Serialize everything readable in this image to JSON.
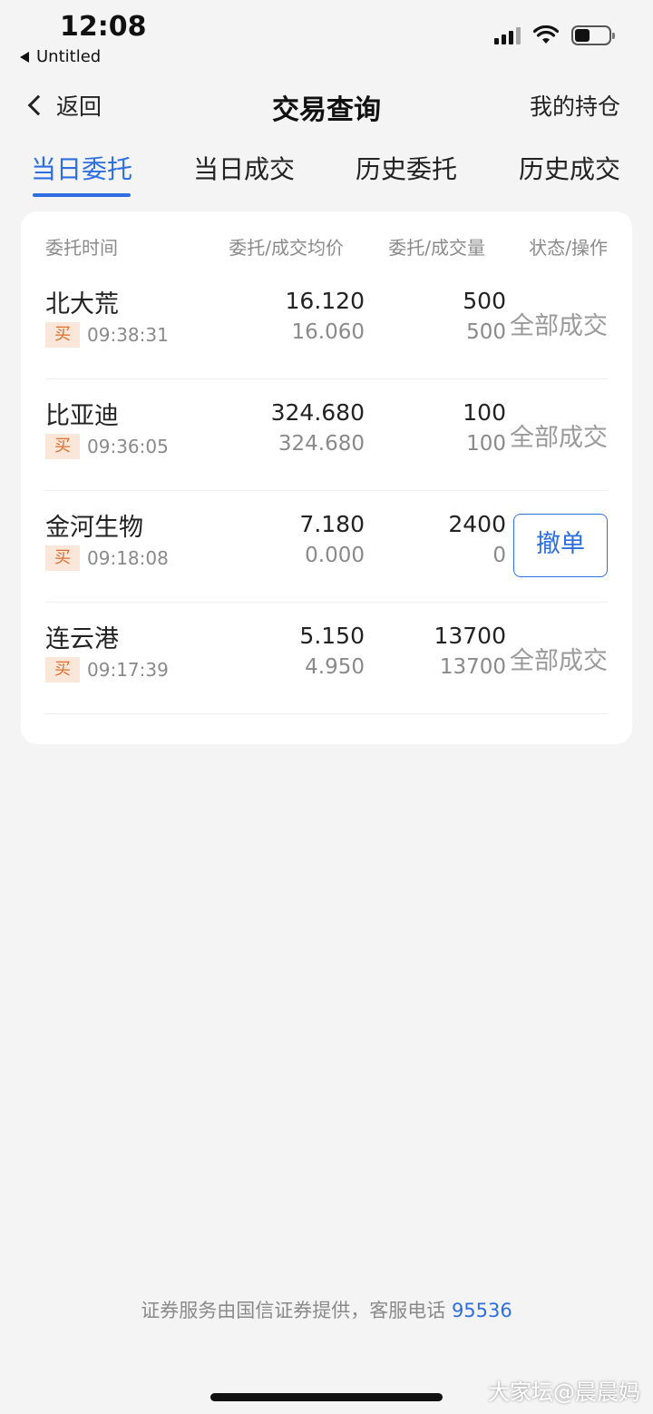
{
  "status_bar": {
    "time": "12:08",
    "back_app": "Untitled"
  },
  "nav": {
    "back_label": "返回",
    "title": "交易查询",
    "right_label": "我的持仓"
  },
  "tabs": [
    {
      "label": "当日委托",
      "active": true
    },
    {
      "label": "当日成交",
      "active": false
    },
    {
      "label": "历史委托",
      "active": false
    },
    {
      "label": "历史成交",
      "active": false
    }
  ],
  "table": {
    "headers": [
      "委托时间",
      "委托/成交均价",
      "委托/成交量",
      "状态/操作"
    ],
    "rows": [
      {
        "name": "北大荒",
        "side": "买",
        "time": "09:38:31",
        "price": "16.120",
        "avg_price": "16.060",
        "qty": "500",
        "filled_qty": "500",
        "status": "全部成交"
      },
      {
        "name": "比亚迪",
        "side": "买",
        "time": "09:36:05",
        "price": "324.680",
        "avg_price": "324.680",
        "qty": "100",
        "filled_qty": "100",
        "status": "全部成交"
      },
      {
        "name": "金河生物",
        "side": "买",
        "time": "09:18:08",
        "price": "7.180",
        "avg_price": "0.000",
        "qty": "2400",
        "filled_qty": "0",
        "action": "撤单"
      },
      {
        "name": "连云港",
        "side": "买",
        "time": "09:17:39",
        "price": "5.150",
        "avg_price": "4.950",
        "qty": "13700",
        "filled_qty": "13700",
        "status": "全部成交"
      }
    ]
  },
  "footer": {
    "text": "证券服务由国信证券提供，客服电话",
    "phone": "95536"
  },
  "watermark": "大家坛@晨晨妈",
  "colors": {
    "accent": "#2d6ee0",
    "buy_badge_bg": "#fbe7d9",
    "buy_badge_text": "#e06c2a",
    "background": "#f4f4f4"
  }
}
